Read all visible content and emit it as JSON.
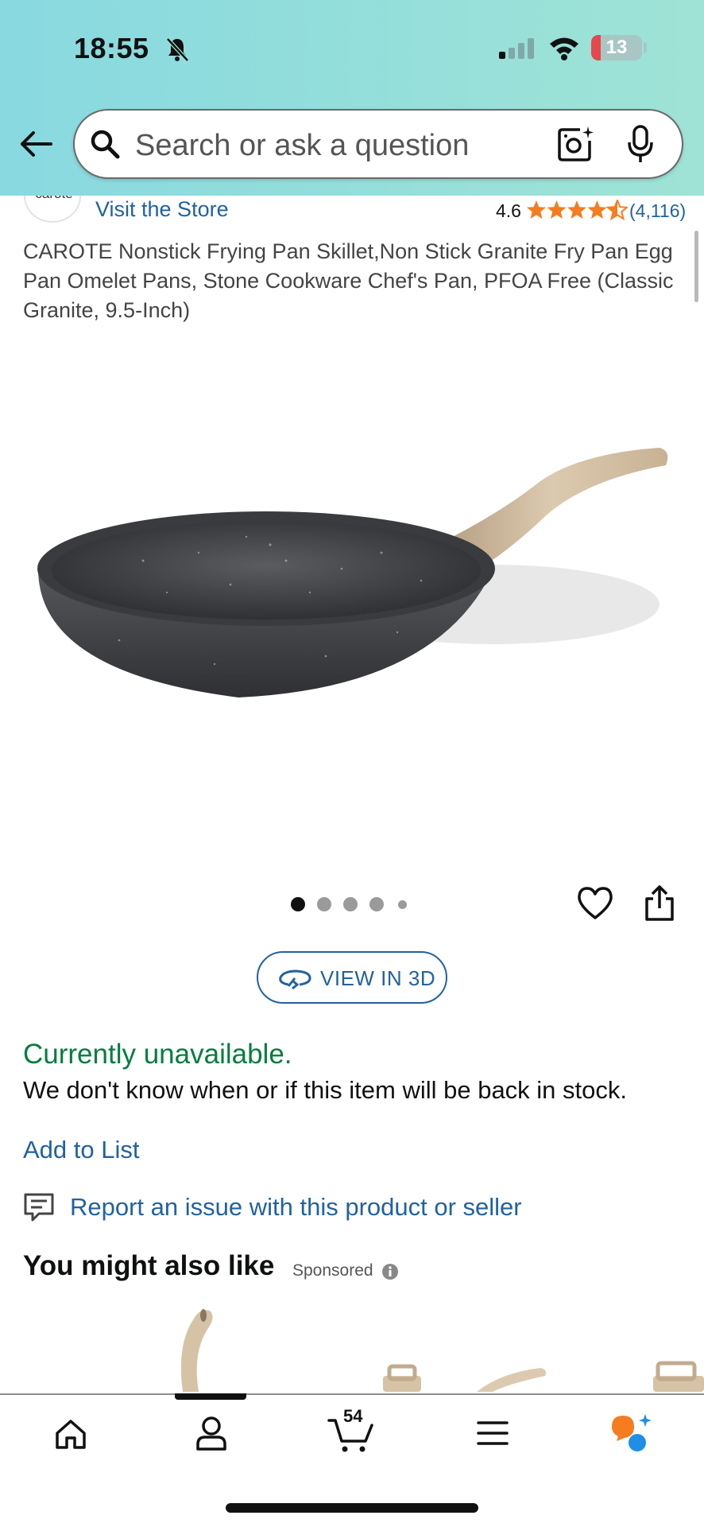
{
  "status_bar": {
    "time": "18:55",
    "battery_level": "13",
    "icons": [
      "bell-slash-icon",
      "signal-icon",
      "wifi-icon",
      "battery-icon"
    ]
  },
  "header": {
    "search_placeholder": "Search or ask a question",
    "icons": [
      "back-arrow-icon",
      "search-icon",
      "camera-icon",
      "microphone-icon"
    ]
  },
  "store": {
    "logo_text": "carote",
    "visit_label": "Visit the Store",
    "rating": "4.6",
    "rating_stars": 4.6,
    "rating_count": "(4,116)"
  },
  "product": {
    "title": "CAROTE Nonstick Frying Pan Skillet,Non Stick Granite Fry Pan Egg Pan Omelet Pans, Stone Cookware Chef's Pan, PFOA Free (Classic Granite, 9.5-Inch)",
    "image_count": 5,
    "current_image": 1,
    "view3d_label": "VIEW IN 3D"
  },
  "availability": {
    "status": "Currently unavailable.",
    "message": "We don't know when or if this item will be back in stock.",
    "status_color": "#067d3f"
  },
  "links": {
    "add_to_list": "Add to List",
    "report_issue": "Report an issue with this product or seller"
  },
  "recommendations": {
    "heading": "You might also like",
    "sponsored_label": "Sponsored"
  },
  "bottom_nav": {
    "items": [
      "home-icon",
      "account-icon",
      "cart-icon",
      "menu-icon",
      "ai-assistant-icon"
    ],
    "cart_count": "54",
    "active_index": 1
  },
  "colors": {
    "link": "#2162a1",
    "star": "#f57c1f",
    "header_gradient_start": "#88d9e0",
    "header_gradient_end": "#9fe3d6"
  }
}
